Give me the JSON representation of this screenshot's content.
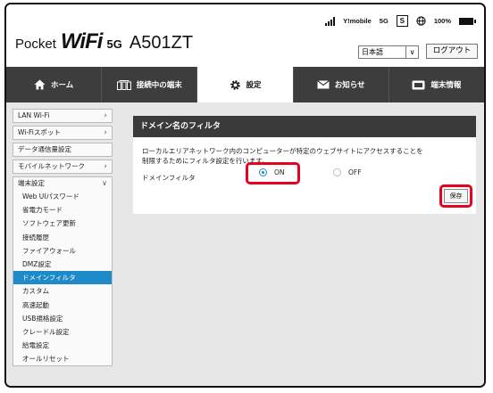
{
  "header": {
    "logo_pocket": "Pocket",
    "logo_wifi": "WiFi",
    "logo_5g": "5G",
    "model": "A501ZT",
    "carrier": "Y!mobile",
    "network": "5G",
    "sim_label": "S",
    "battery": "100%",
    "language": "日本語",
    "logout_label": "ログアウト"
  },
  "tabs": [
    {
      "label": "ホーム",
      "icon": "home-icon"
    },
    {
      "label": "接続中の端末",
      "icon": "devices-icon"
    },
    {
      "label": "設定",
      "icon": "gear-icon",
      "active": true
    },
    {
      "label": "お知らせ",
      "icon": "mail-icon"
    },
    {
      "label": "端末情報",
      "icon": "device-info-icon"
    }
  ],
  "sidebar": {
    "items": [
      {
        "label": "LAN Wi-Fi",
        "chevron": "right"
      },
      {
        "label": "Wi-Fiスポット",
        "chevron": "right"
      },
      {
        "label": "データ通信量設定",
        "chevron": ""
      },
      {
        "label": "モバイルネットワーク",
        "chevron": "right"
      }
    ],
    "group": {
      "label": "端末設定",
      "chevron": "down",
      "subitems": [
        "Web UIパスワード",
        "省電力モード",
        "ソフトウェア更新",
        "接続履歴",
        "ファイアウォール",
        "DMZ設定",
        "ドメインフィルタ",
        "カスタム",
        "高速起動",
        "USB規格設定",
        "クレードル設定",
        "給電設定",
        "オールリセット"
      ],
      "active_index": 6
    }
  },
  "panel": {
    "title": "ドメイン名のフィルタ",
    "desc_line1": "ローカルエリアネットワーク内のコンピューターが特定のウェブサイトにアクセスすることを",
    "desc_line2": "制限するためにフィルタ設定を行います。",
    "field_label": "ドメインフィルタ",
    "on_label": "ON",
    "off_label": "OFF",
    "selected": "ON",
    "save_label": "保存"
  },
  "colors": {
    "accent": "#1e8ac8",
    "highlight": "#e8001f",
    "tabbar": "#3d3d3d"
  }
}
